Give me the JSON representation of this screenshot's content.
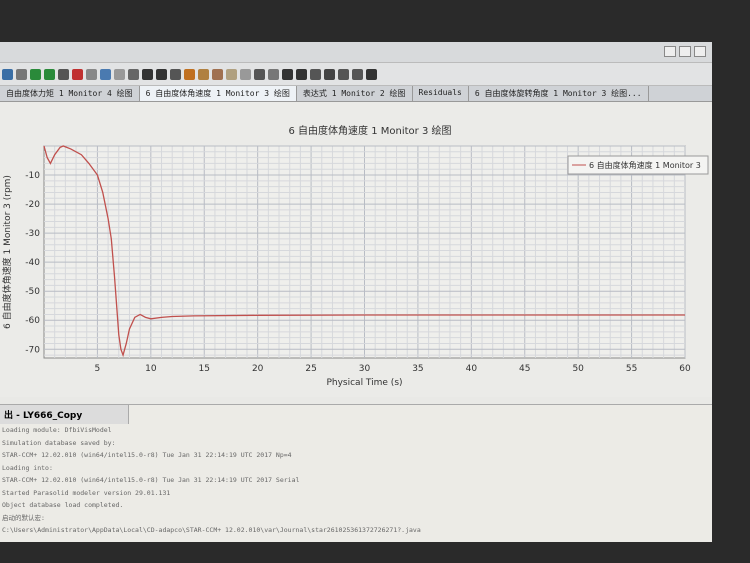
{
  "tabs": [
    "自由度体力矩 1 Monitor 4 绘图",
    "6 自由度体角速度 1 Monitor 3 绘图",
    "表达式 1 Monitor 2 绘图",
    "Residuals",
    "6 自由度体旋转角度 1 Monitor 3 绘图..."
  ],
  "active_tab": 1,
  "chart_data": {
    "type": "line",
    "title": "6 自由度体角速度 1 Monitor 3 绘图",
    "xlabel": "Physical Time (s)",
    "ylabel": "6 自由度体角速度 1 Monitor 3 (rpm)",
    "xlim": [
      0,
      60
    ],
    "ylim": [
      -73,
      0
    ],
    "xticks": [
      5,
      10,
      15,
      20,
      25,
      30,
      35,
      40,
      45,
      50,
      55,
      60
    ],
    "yticks": [
      -10,
      -20,
      -30,
      -40,
      -50,
      -60,
      -70
    ],
    "grid": true,
    "legend": "top-right",
    "line_color": "#c0504d",
    "series": [
      {
        "name": "6 自由度体角速度 1 Monitor 3",
        "x": [
          0,
          0.3,
          0.6,
          1.0,
          1.5,
          1.8,
          2.5,
          3.5,
          4.2,
          5.0,
          5.5,
          6.0,
          6.3,
          6.6,
          6.8,
          7.0,
          7.2,
          7.4,
          7.7,
          8.0,
          8.5,
          9.0,
          9.5,
          10,
          11,
          12,
          14,
          20,
          30,
          40,
          50,
          60
        ],
        "y": [
          0,
          -4,
          -6,
          -3,
          -0.5,
          0,
          -1,
          -3,
          -6,
          -10,
          -16,
          -25,
          -32,
          -45,
          -55,
          -65,
          -70,
          -72,
          -68,
          -63,
          -59,
          -58,
          -59,
          -59.5,
          -59,
          -58.7,
          -58.5,
          -58.3,
          -58.2,
          -58.2,
          -58.2,
          -58.2
        ]
      }
    ]
  },
  "log": {
    "tab": "出 - LY666_Copy",
    "lines": [
      "Loading module: DfbiVisModel",
      "Simulation database saved by:",
      "  STAR-CCM+ 12.02.010 (win64/intel15.0-r8) Tue Jan 31 22:14:19 UTC 2017 Np=4",
      "Loading into:",
      "  STAR-CCM+ 12.02.010 (win64/intel15.0-r8) Tue Jan 31 22:14:19 UTC 2017 Serial",
      "Started Parasolid modeler version 29.01.131",
      "Object database load completed.",
      "启动的默认宏:",
      "C:\\Users\\Administrator\\AppData\\Local\\CD-adapco\\STAR-CCM+ 12.02.010\\var\\Journal\\star261025361372726271?.java"
    ]
  }
}
